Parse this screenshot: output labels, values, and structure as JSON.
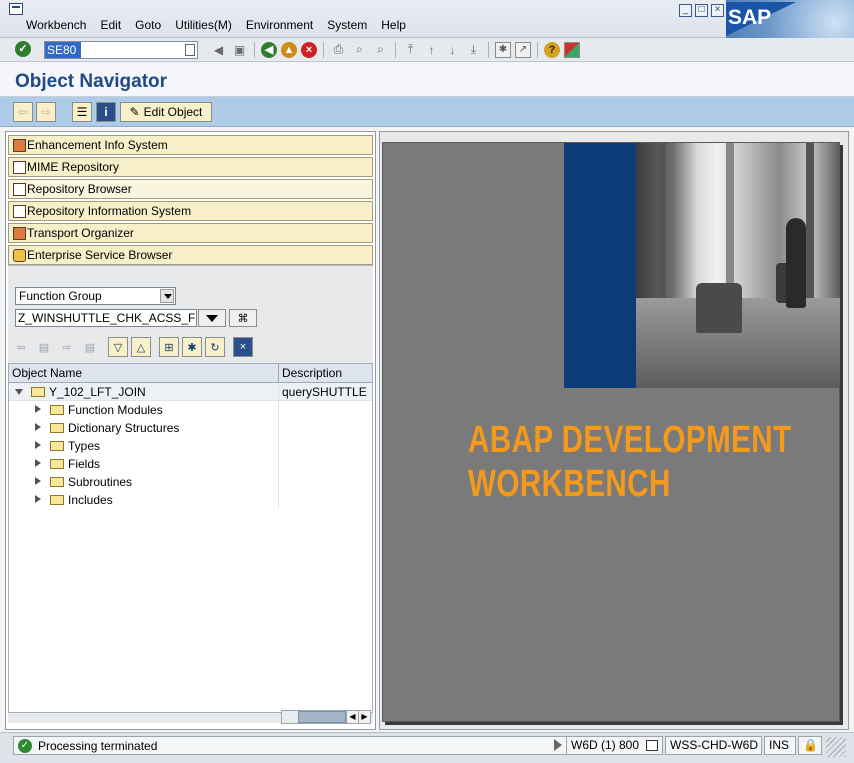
{
  "menu": {
    "items": [
      "Workbench",
      "Edit",
      "Goto",
      "Utilities(M)",
      "Environment",
      "System",
      "Help"
    ],
    "logo_text": "SAP"
  },
  "toolbar": {
    "command_value": "SE80"
  },
  "title": "Object Navigator",
  "app_toolbar": {
    "edit_object_label": "Edit Object"
  },
  "navigator": {
    "buttons": [
      {
        "label": "Enhancement Info System",
        "icon": "enhancement-icon"
      },
      {
        "label": "MIME Repository",
        "icon": "mime-icon"
      },
      {
        "label": "Repository Browser",
        "icon": "hierarchy-icon"
      },
      {
        "label": "Repository Information System",
        "icon": "info-system-icon"
      },
      {
        "label": "Transport Organizer",
        "icon": "truck-icon"
      },
      {
        "label": "Enterprise Service Browser",
        "icon": "service-icon"
      }
    ],
    "object_type": "Function Group",
    "object_name": "Z_WINSHUTTLE_CHK_ACSS_F"
  },
  "tree": {
    "columns": [
      "Object Name",
      "Description"
    ],
    "root": {
      "name": "Y_102_LFT_JOIN",
      "description": "querySHUTTLE"
    },
    "children": [
      "Function Modules",
      "Dictionary Structures",
      "Types",
      "Fields",
      "Subroutines",
      "Includes"
    ]
  },
  "splash": {
    "line1": "ABAP DEVELOPMENT",
    "line2": "WORKBENCH"
  },
  "status": {
    "message": "Processing terminated",
    "system": "W6D (1) 800",
    "server": "WSS-CHD-W6D",
    "mode": "INS"
  },
  "colors": {
    "title": "#1f4a84",
    "app_toolbar": "#aecbe8",
    "nav_button": "#f7efc8",
    "splash_text": "#f39a1c"
  }
}
